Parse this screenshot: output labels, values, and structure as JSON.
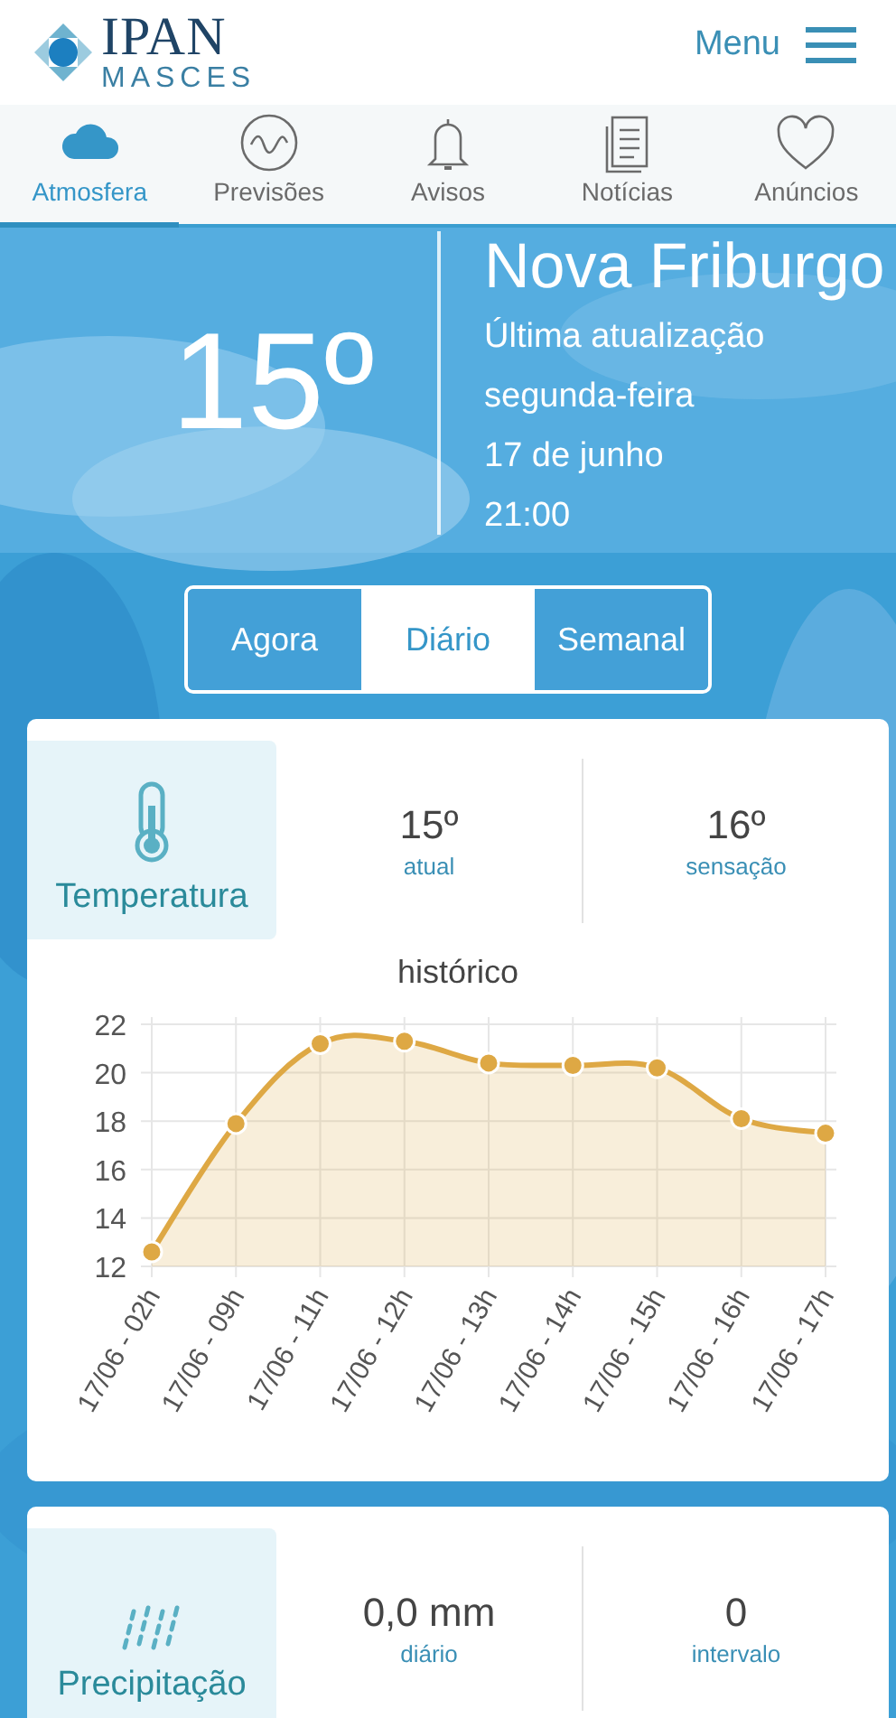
{
  "header": {
    "logo_title": "IPAN",
    "logo_subtitle": "MASCES",
    "menu_label": "Menu"
  },
  "tabs": [
    {
      "label": "Atmosfera",
      "selected": true
    },
    {
      "label": "Previsões",
      "selected": false
    },
    {
      "label": "Avisos",
      "selected": false
    },
    {
      "label": "Notícias",
      "selected": false
    },
    {
      "label": "Anúncios",
      "selected": false
    }
  ],
  "current": {
    "temperature": "15º",
    "city": "Nova Friburgo",
    "update_label": "Última atualização",
    "weekday": "segunda-feira",
    "date": "17 de junho",
    "time": "21:00"
  },
  "periods": [
    {
      "label": "Agora",
      "selected": false
    },
    {
      "label": "Diário",
      "selected": true
    },
    {
      "label": "Semanal",
      "selected": false
    }
  ],
  "cards": [
    {
      "kind": "temperature",
      "title": "Temperatura",
      "stats": [
        {
          "value": "15º",
          "label": "atual"
        },
        {
          "value": "16º",
          "label": "sensação"
        }
      ],
      "chart_title": "histórico",
      "chart_data": {
        "type": "area",
        "grid": true,
        "categories": [
          "17/06 - 02h",
          "17/06 - 09h",
          "17/06 - 11h",
          "17/06 - 12h",
          "17/06 - 13h",
          "17/06 - 14h",
          "17/06 - 15h",
          "17/06 - 16h",
          "17/06 - 17h"
        ],
        "series": [
          {
            "color": "#dea844",
            "values": [
              12.6,
              17.9,
              21.2,
              21.3,
              20.4,
              20.3,
              20.2,
              18.1,
              17.5
            ]
          }
        ],
        "ylim": [
          12,
          22
        ],
        "yticks": [
          12,
          14,
          16,
          18,
          20,
          22
        ]
      }
    },
    {
      "kind": "precipitation",
      "title": "Precipitação",
      "stats": [
        {
          "value": "0,0 mm",
          "label": "diário"
        },
        {
          "value": "0",
          "label": "intervalo"
        }
      ]
    }
  ]
}
